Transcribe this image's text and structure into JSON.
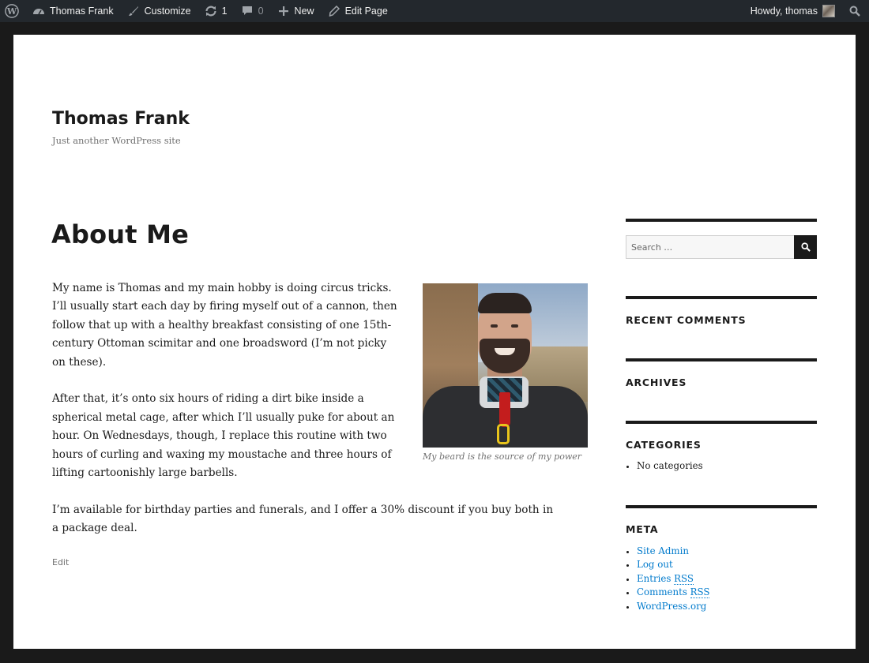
{
  "adminbar": {
    "wp_logo": "wordpress-logo",
    "site_name": "Thomas Frank",
    "customize": "Customize",
    "updates_count": "1",
    "comments_count": "0",
    "new_label": "New",
    "edit_page": "Edit Page",
    "howdy": "Howdy, thomas"
  },
  "site": {
    "title": "Thomas Frank",
    "description": "Just another WordPress site"
  },
  "entry": {
    "title": "About Me",
    "paragraphs": [
      "My name is Thomas and my main hobby is doing circus tricks. I’ll usually start each day by firing myself out of a cannon, then follow that up with a healthy breakfast consisting of one 15th-century Ottoman scimitar and one broadsword (I’m not picky on these).",
      "After that, it’s onto six hours of riding a dirt bike inside a spherical metal cage, after which I’ll usually puke for about an hour. On Wednesdays, though, I replace this routine with two hours of curling and waxing my moustache and three hours of lifting cartoonishly large barbells.",
      "I’m available for birthday parties and funerals, and I offer a 30% discount if you buy both in a package deal."
    ],
    "image_caption": "My beard is the source of my power",
    "edit_label": "Edit"
  },
  "sidebar": {
    "search": {
      "placeholder": "Search …"
    },
    "recent_comments": {
      "title": "Recent Comments"
    },
    "archives": {
      "title": "Archives"
    },
    "categories": {
      "title": "Categories",
      "items": [
        "No categories"
      ]
    },
    "meta": {
      "title": "Meta",
      "items": [
        {
          "label": "Site Admin"
        },
        {
          "label": "Log out"
        },
        {
          "pre": "Entries ",
          "abbr": "RSS"
        },
        {
          "pre": "Comments ",
          "abbr": "RSS"
        },
        {
          "label": "WordPress.org"
        }
      ]
    }
  },
  "colors": {
    "adminbar_bg": "#23282d",
    "frame_bg": "#1a1a1a",
    "link": "#007acc",
    "text": "#1a1a1a",
    "muted": "#707070"
  }
}
